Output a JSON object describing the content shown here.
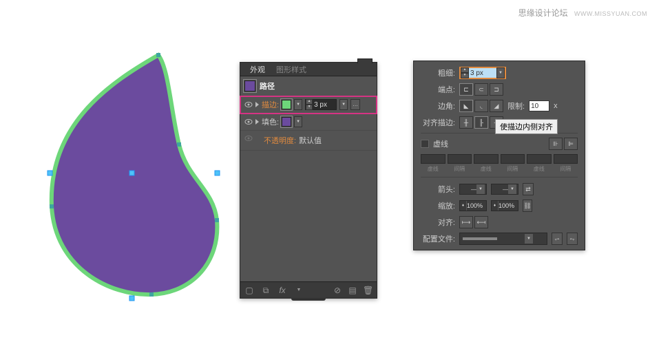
{
  "watermark": {
    "label": "思缘设计论坛",
    "url": "WWW.MISSYUAN.COM"
  },
  "shape": {
    "fill": "#6b4b9e",
    "stroke": "#6dd67a",
    "strokeWidth": 5
  },
  "appearance": {
    "tabs": [
      "外观",
      "图形样式"
    ],
    "headerTitle": "路径",
    "strokeLabel": "描边:",
    "strokeColor": "#6dd67a",
    "strokeWeight": "3 px",
    "fillLabel": "填色:",
    "fillColor": "#6b4b9e",
    "opacityLabel": "不透明度:",
    "opacityValue": "默认值",
    "fxLabel": "fx"
  },
  "stroke": {
    "weightLabel": "粗细:",
    "weightValue": "3 px",
    "capLabel": "端点:",
    "cornerLabel": "边角:",
    "limitLabel": "限制:",
    "limitValue": "10",
    "limitUnit": "x",
    "alignLabel": "对齐描边:",
    "tooltip": "使描边内侧对齐",
    "dashedLabel": "虚线",
    "dashCols": [
      "虚线",
      "间隔",
      "虚线",
      "间隔",
      "虚线",
      "间隔"
    ],
    "arrowLabel": "箭头:",
    "scaleLabel": "缩放:",
    "scaleValue": "100%",
    "alignArrowLabel": "对齐:",
    "profileLabel": "配置文件:"
  }
}
